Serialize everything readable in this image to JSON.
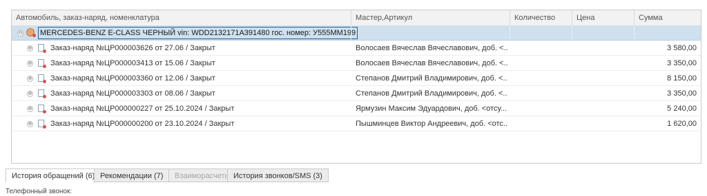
{
  "grid": {
    "columns": [
      "Автомобиль, заказ-наряд, номенклатура",
      "Мастер,Артикул",
      "Количество",
      "Цена",
      "Сумма"
    ],
    "vehicle": {
      "toggle": "⊖",
      "label": "MERCEDES-BENZ E-CLASS ЧЕРНЫЙ vin: WDD2132171A391480 гос. номер: У555ММ199"
    },
    "orders": [
      {
        "toggle": "⊕",
        "label": "Заказ-наряд №ЦР000003626 от 27.06 / Закрыт",
        "master": "Волосаев Вячеслав Вячеславович, доб. <...",
        "sum": "3 580,00"
      },
      {
        "toggle": "⊕",
        "label": "Заказ-наряд №ЦР000003413 от 15.06 / Закрыт",
        "master": "Волосаев Вячеслав Вячеславович, доб. <...",
        "sum": "3 350,00"
      },
      {
        "toggle": "⊕",
        "label": "Заказ-наряд №ЦР000003360 от 12.06 / Закрыт",
        "master": "Степанов Дмитрий Владимирович, доб. <...",
        "sum": "8 150,00"
      },
      {
        "toggle": "⊕",
        "label": "Заказ-наряд №ЦР000003303 от 08.06 / Закрыт",
        "master": "Степанов Дмитрий Владимирович, доб. <...",
        "sum": "3 350,00"
      },
      {
        "toggle": "⊕",
        "label": "Заказ-наряд №ЦР000000227 от 25.10.2024 / Закрыт",
        "master": "Ярмузин Максим Эдуардович, доб. <отсу...",
        "sum": "5 240,00"
      },
      {
        "toggle": "⊕",
        "label": "Заказ-наряд №ЦР000000200 от 23.10.2024 / Закрыт",
        "master": "Пышминцев Виктор Андреевич, доб. <отс...",
        "sum": "1 620,00"
      }
    ]
  },
  "tabs": [
    {
      "label": "История обращений (6)",
      "state": "active"
    },
    {
      "label": "Рекомендации (7)",
      "state": "normal"
    },
    {
      "label": "Взаиморасчеты",
      "state": "disabled"
    },
    {
      "label": "История звонков/SMS (3)",
      "state": "normal"
    }
  ],
  "phone_label": "Телефонный звонок:"
}
